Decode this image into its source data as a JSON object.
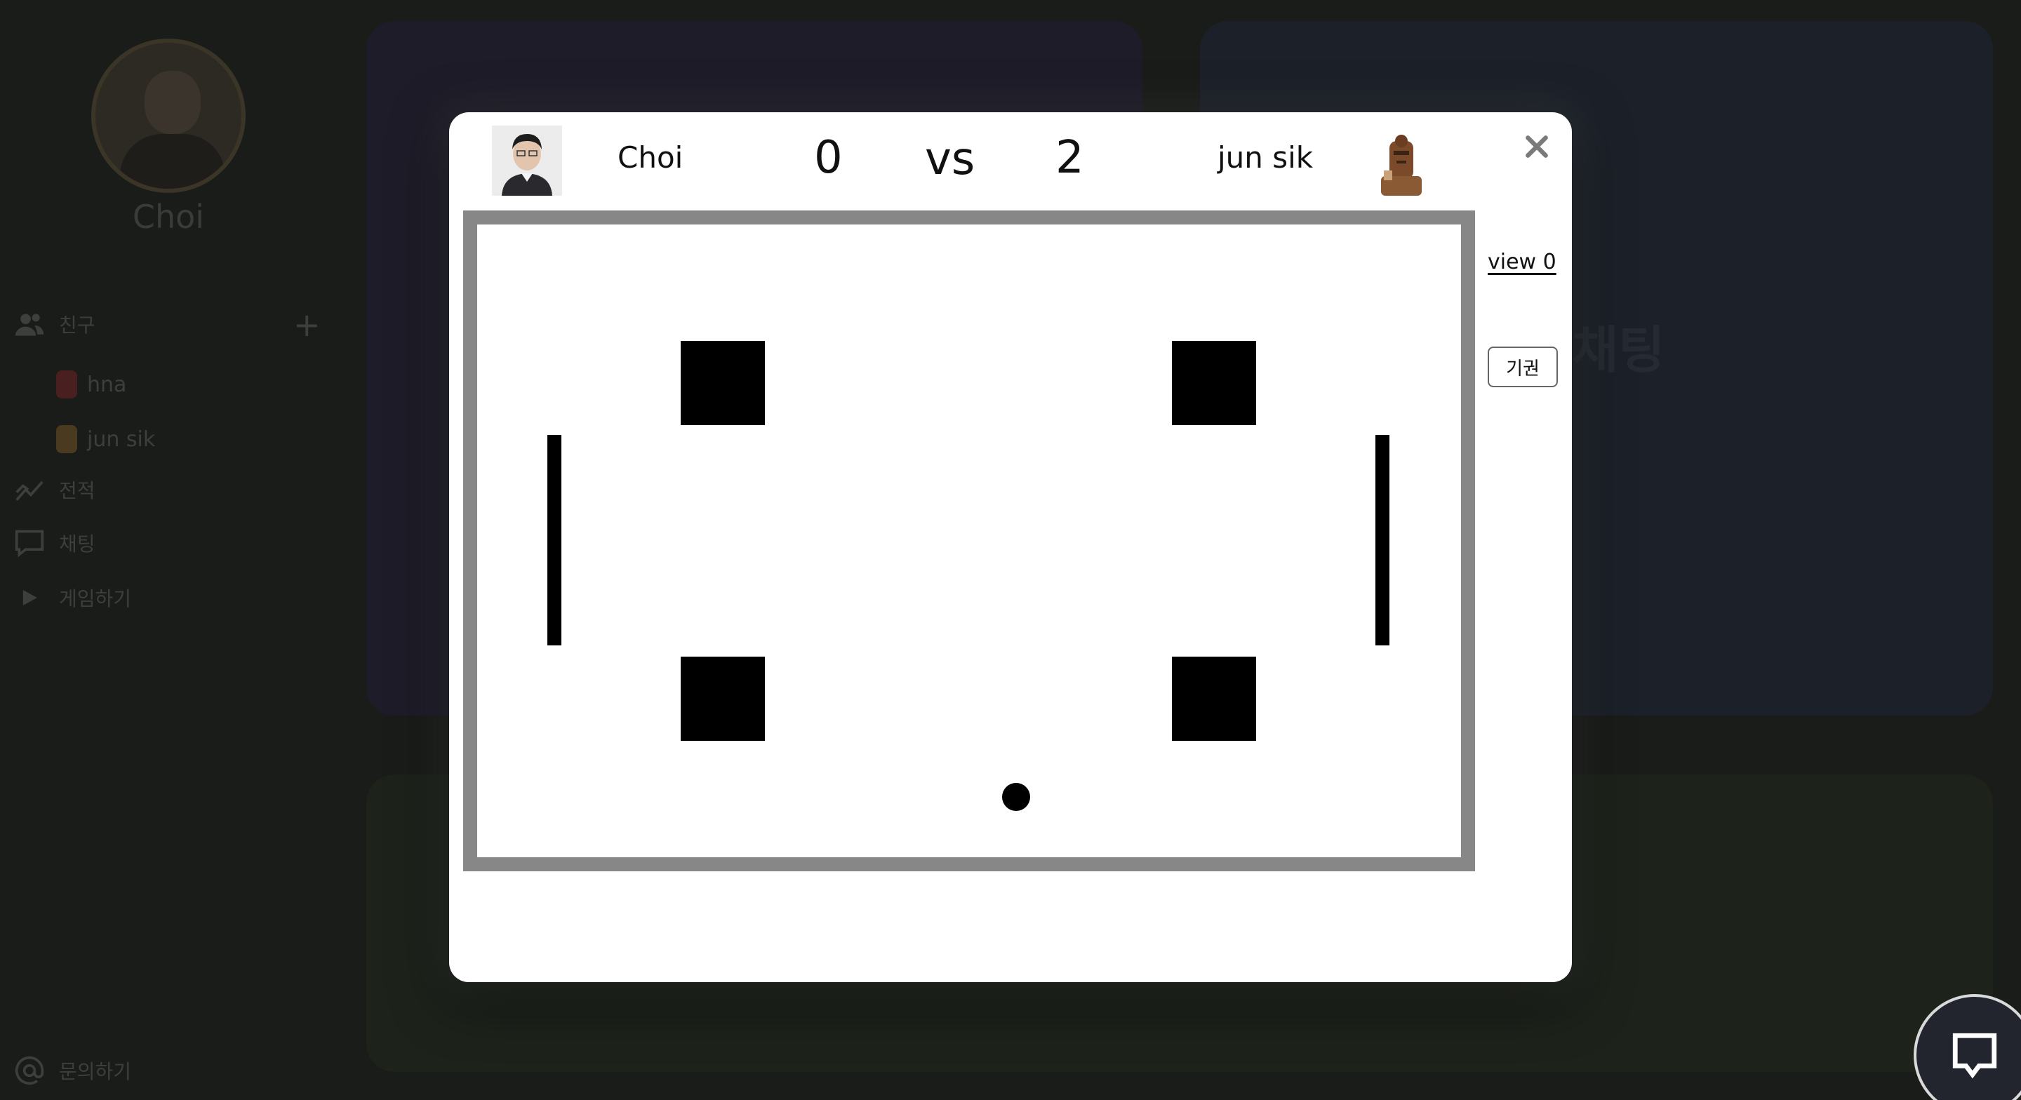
{
  "sidebar": {
    "profile_name": "Choi",
    "friends_label": "친구",
    "add_friend_icon": "plus-icon",
    "friends": [
      {
        "name": "hna",
        "color": "#4a1f1f"
      },
      {
        "name": "jun sik",
        "color": "#4a3a1f"
      }
    ],
    "stats_label": "전적",
    "chat_label": "채팅",
    "play_label": "게임하기",
    "inquiry_label": "문의하기"
  },
  "background": {
    "chat_panel_title": "채팅"
  },
  "modal": {
    "left_player": {
      "name": "Choi",
      "score": "0"
    },
    "vs_label": "vs",
    "right_player": {
      "name": "jun sik",
      "score": "2"
    },
    "view_label": "view 0",
    "forfeit_label": "기권",
    "close_icon": "close-icon"
  },
  "colors": {
    "board_border": "#878787",
    "modal_bg": "#ffffff",
    "page_bg": "#1a1c1a"
  }
}
